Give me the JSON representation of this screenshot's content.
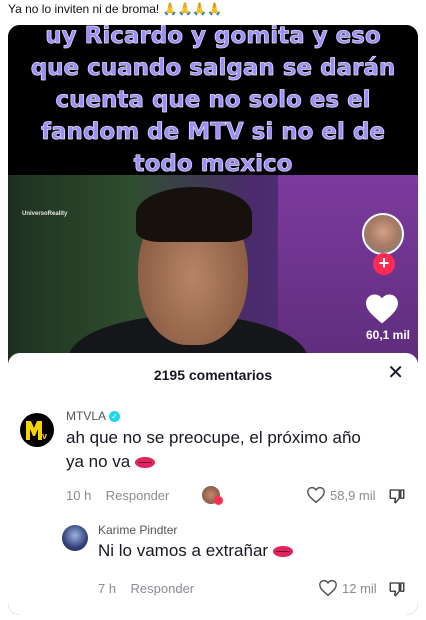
{
  "post_caption": "Ya no lo inviten ni de broma! 🙏🙏🙏🙏",
  "overlay_text": "uy Ricardo y gomita y eso que cuando salgan se darán cuenta que no solo es el fandom de MTV si no el de todo mexico",
  "video": {
    "watermark": "UniversoReality",
    "like_count": "60,1 mil"
  },
  "comments_sheet": {
    "title": "2195 comentarios",
    "comments": [
      {
        "username": "MTVLA",
        "verified": true,
        "text": "ah que no se preocupe, el próximo año ya no va",
        "time": "10 h",
        "reply_label": "Responder",
        "likes": "58,9 mil"
      },
      {
        "username": "Karime Pindter",
        "verified": false,
        "text": "Ni lo vamos a extrañar",
        "time": "7 h",
        "reply_label": "Responder",
        "likes": "12 mil"
      }
    ]
  },
  "colors": {
    "overlay_text": "#9b8cff",
    "follow": "#fe2c55",
    "verified": "#20d5ec"
  }
}
